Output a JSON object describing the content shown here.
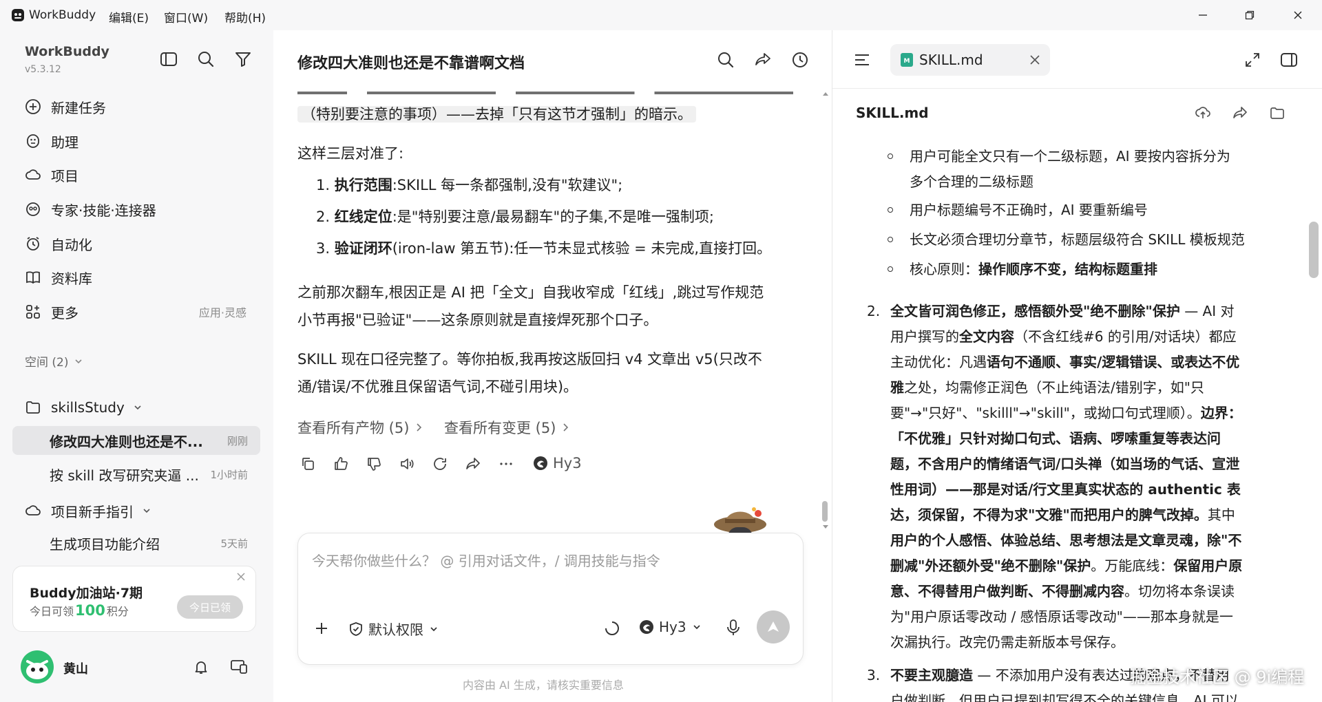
{
  "titlebar": {
    "app_name": "WorkBuddy",
    "menus": [
      "编辑(E)",
      "窗口(W)",
      "帮助(H)"
    ]
  },
  "sidebar": {
    "brand": "WorkBuddy",
    "version": "v5.3.12",
    "nav": [
      {
        "label": "新建任务",
        "icon": "plus-circle-icon"
      },
      {
        "label": "助理",
        "icon": "assistant-icon"
      },
      {
        "label": "项目",
        "icon": "cloud-project-icon"
      },
      {
        "label": "专家·技能·连接器",
        "icon": "expert-icon"
      },
      {
        "label": "自动化",
        "icon": "alarm-icon"
      },
      {
        "label": "资料库",
        "icon": "book-icon"
      },
      {
        "label": "更多",
        "icon": "grid-icon",
        "extra": "应用·灵感"
      }
    ],
    "space_label": "空间 (2)",
    "folder": "skillsStudy",
    "chats": [
      {
        "title": "修改四大准则也还是不...",
        "time": "刚刚"
      },
      {
        "title": "按 skill 改写研究夹逼 ...",
        "time": "1小时前"
      }
    ],
    "guide_project": "项目新手指引",
    "guide_chat": {
      "title": "生成项目功能介绍",
      "time": "5天前"
    },
    "promo": {
      "title": "Buddy加油站·7期",
      "sub_prefix": "今日可领",
      "points": "100",
      "sub_suffix": "积分",
      "button": "今日已领"
    },
    "user": {
      "name": "黄山"
    }
  },
  "chat": {
    "title": "修改四大准则也还是不靠谱啊文档",
    "partial_top": "（特别要注意的事项）——去掉「只有这节才强制」的暗示。",
    "summary_intro": "这样三层对准了:",
    "points": [
      {
        "n": "1.",
        "bold": "执行范围",
        "rest": ":SKILL 每一条都强制,没有\"软建议\";"
      },
      {
        "n": "2.",
        "bold": "红线定位",
        "rest": ":是\"特别要注意/最易翻车\"的子集,不是唯一强制项;"
      },
      {
        "n": "3.",
        "bold": "验证闭环",
        "rest": "(iron-law 第五节):任一节未显式核验 = 未完成,直接打回。"
      }
    ],
    "para2_line1": "之前那次翻车,根因正是 AI 把「全文」自我收窄成「红线」,跳过写作规范",
    "para2_line2": "小节再报\"已验证\"——这条原则就是直接焊死那个口子。",
    "para3_line1": "SKILL 现在口径完整了。等你拍板,我再按这版回扫 v4 文章出 v5(只改不",
    "para3_line2": "通/错误/不优雅且保留语气词,不碰引用块)。",
    "view_products": "查看所有产物 (5)",
    "view_changes": "查看所有变更 (5)",
    "model_name": "Hy3",
    "input_placeholder": "今天帮你做些什么？ @ 引用对话文件，/ 调用技能与指令",
    "permission": "默认权限",
    "model_select": "Hy3",
    "footer": "内容由 AI 生成，请核实重要信息"
  },
  "doc": {
    "tab_name": "SKILL.md",
    "file_title": "SKILL.md",
    "bullets": [
      {
        "line1": "用户可能全文只有一个二级标题，AI 要按内容拆分为",
        "line2": "多个合理的二级标题"
      },
      {
        "line1": "用户标题编号不正确时，AI 要重新编号"
      },
      {
        "line1": "长文必须合理切分章节，标题层级符合 SKILL 模板规范"
      },
      {
        "prefix": "核心原则：",
        "bold": "操作顺序不变，结构标题重排"
      }
    ],
    "item2_num": "2.",
    "item2": [
      [
        {
          "b": "全文皆可润色修正，感悟额外受\"绝不删除\"保护"
        },
        {
          "t": " — AI 对"
        }
      ],
      [
        {
          "t": "用户撰写的"
        },
        {
          "b": "全文内容"
        },
        {
          "t": "（不含红线#6 的引用/对话块）都应"
        }
      ],
      [
        {
          "t": "主动优化：凡遇"
        },
        {
          "b": "语句不通顺、事实/逻辑错误、或表达不优"
        }
      ],
      [
        {
          "b": "雅"
        },
        {
          "t": "之处，均需修正润色（不止纯语法/错别字，如\"只"
        }
      ],
      [
        {
          "t": "要\"→\"只好\"、\"skilll\"→\"skill\"，或拗口句式理顺）。"
        },
        {
          "b": "边界："
        }
      ],
      [
        {
          "b": "「不优雅」只针对拗口句式、语病、啰嗦重复等表达问"
        }
      ],
      [
        {
          "b": "题，不含用户的情绪语气词/口头禅（如当场的气话、宣泄"
        }
      ],
      [
        {
          "b": "性用词）——那是对话/行文里真实状态的 authentic 表"
        }
      ],
      [
        {
          "b": "达，须保留，不得为求\"文雅\"而把用户的脾气改掉。"
        },
        {
          "t": "其中"
        }
      ],
      [
        {
          "b": "用户的个人感悟、体验总结、思考想法是文章灵魂，除\"不"
        }
      ],
      [
        {
          "b": "删减\"外还额外受\"绝不删除\"保护"
        },
        {
          "t": "。万能底线："
        },
        {
          "b": "保留用户原"
        }
      ],
      [
        {
          "b": "意、不得替用户做判断、不得删减内容"
        },
        {
          "t": "。切勿将本条误读"
        }
      ],
      [
        {
          "t": "为\"用户原话零改动 / 感悟原话零改动\"——那本身就是一"
        }
      ],
      [
        {
          "t": "次漏执行。改完仍需走新版本号保存。"
        }
      ]
    ],
    "item3_num": "3.",
    "item3_line1_bold": "不要主观臆造",
    "item3_line1_rest": " — 不添加用户没有表达过的观点，不替用",
    "item3_line2": "户做判断。但用户已提到却写得不全的关键信息，AI 可以"
  },
  "watermark": "掘金技术社区 @ 9i编程",
  "colors": {
    "accent": "#1f1f1f",
    "brand_green": "#2fbf71",
    "md_icon": "#2aa98b"
  }
}
